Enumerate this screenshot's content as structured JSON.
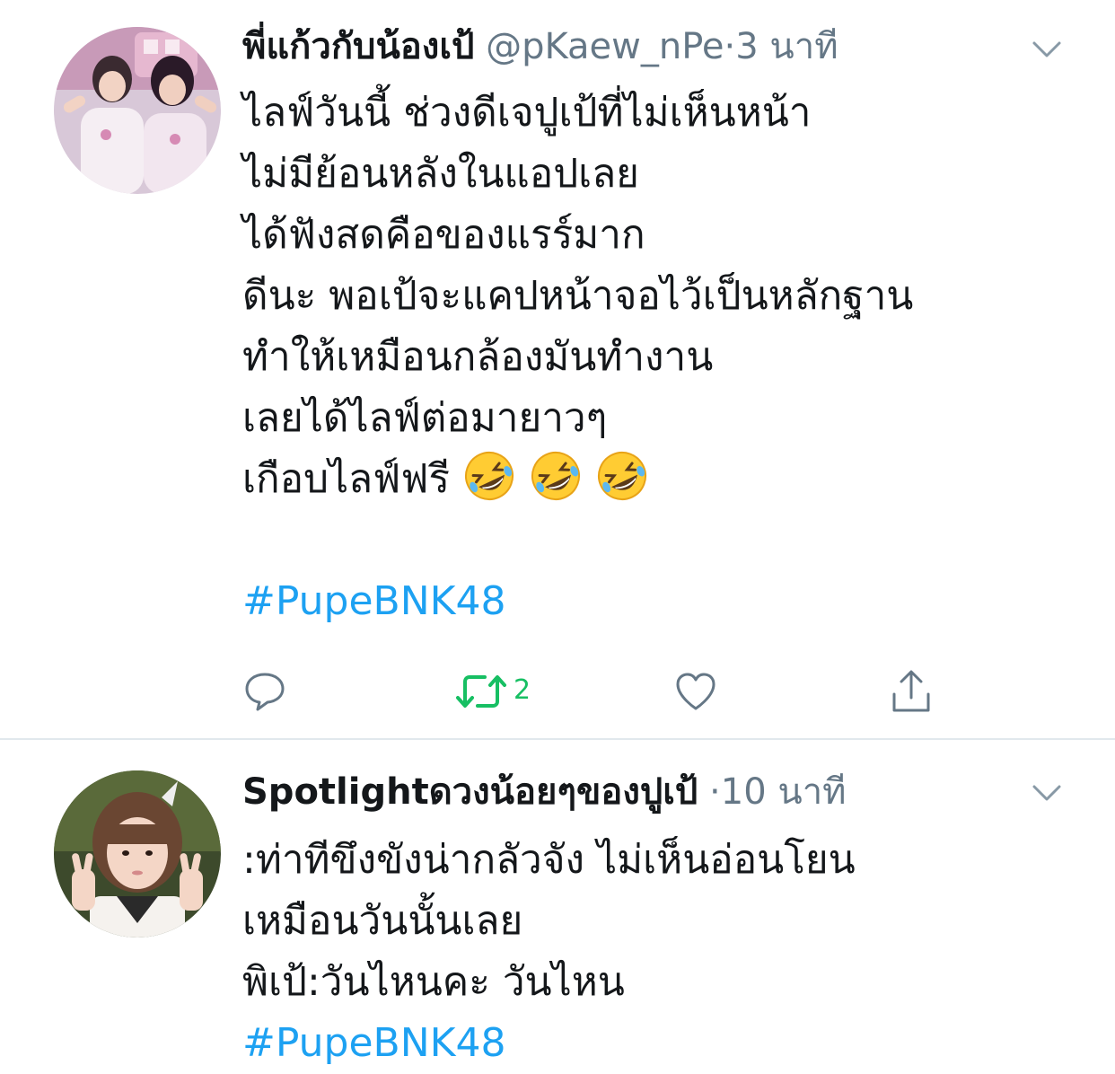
{
  "tweets": [
    {
      "display_name": "พี่แก้วกับน้องเป้",
      "handle": "@pKaew_nPe",
      "separator": "·",
      "time": "3 นาที",
      "lines": [
        "ไลฟ์วันนี้ ช่วงดีเจปูเป้ที่ไม่เห็นหน้า",
        "ไม่มีย้อนหลังในแอปเลย",
        "ได้ฟังสดคือของแรร์มาก",
        "ดีนะ พอเป้จะแคปหน้าจอไว้เป็นหลักฐาน",
        "ทำให้เหมือนกล้องมันทำงาน",
        "เลยได้ไลฟ์ต่อมายาวๆ",
        "เกือบไลฟ์ฟรี"
      ],
      "emojis": [
        "rolling-on-floor-laughing-emoji",
        "rolling-on-floor-laughing-emoji",
        "rolling-on-floor-laughing-emoji"
      ],
      "hashtag": "#PupeBNK48",
      "retweet_count": "2",
      "avatar": "two-girls-photo-avatar"
    },
    {
      "display_name": "Spotlightดวงน้อยๆของปูเป้",
      "separator": "·",
      "time": "10 นาที",
      "lines": [
        ":ท่าทีขึงขังน่ากลัวจัง ไม่เห็นอ่อนโยน",
        "เหมือนวันนั้นเลย",
        "พิเป้:วันไหนคะ วันไหน"
      ],
      "hashtag": "#PupeBNK48",
      "avatar": "girl-peace-sign-photo-avatar"
    }
  ],
  "colors": {
    "text": "#14171a",
    "secondary": "#657786",
    "link": "#1da1f2",
    "retweet": "#17bf63",
    "divider": "#e1e8ed"
  },
  "icons": {
    "reply": "reply-icon",
    "retweet": "retweet-icon",
    "like": "heart-icon",
    "share": "share-icon",
    "caret": "chevron-down-icon"
  }
}
